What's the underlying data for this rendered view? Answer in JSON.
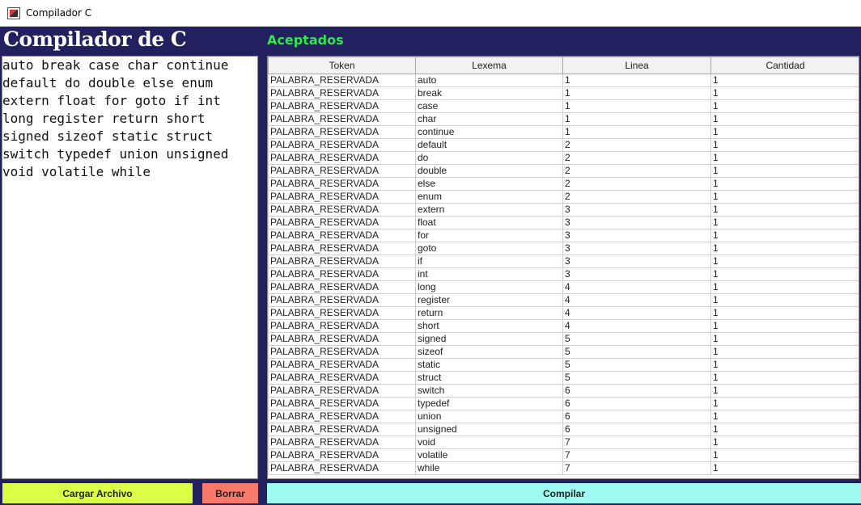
{
  "window": {
    "title": "Compilador C",
    "icon": "java-cup-icon"
  },
  "editor": {
    "heading": "Compilador de C",
    "content": "auto break case char continue\ndefault do double else enum\nextern float for goto if int\nlong register return short\nsigned sizeof static struct\nswitch typedef union unsigned\nvoid volatile while"
  },
  "results": {
    "heading": "Aceptados",
    "columns": [
      "Token",
      "Lexema",
      "Linea",
      "Cantidad"
    ],
    "rows": [
      [
        "PALABRA_RESERVADA",
        "auto",
        "1",
        "1"
      ],
      [
        "PALABRA_RESERVADA",
        "break",
        "1",
        "1"
      ],
      [
        "PALABRA_RESERVADA",
        "case",
        "1",
        "1"
      ],
      [
        "PALABRA_RESERVADA",
        "char",
        "1",
        "1"
      ],
      [
        "PALABRA_RESERVADA",
        "continue",
        "1",
        "1"
      ],
      [
        "PALABRA_RESERVADA",
        "default",
        "2",
        "1"
      ],
      [
        "PALABRA_RESERVADA",
        "do",
        "2",
        "1"
      ],
      [
        "PALABRA_RESERVADA",
        "double",
        "2",
        "1"
      ],
      [
        "PALABRA_RESERVADA",
        "else",
        "2",
        "1"
      ],
      [
        "PALABRA_RESERVADA",
        "enum",
        "2",
        "1"
      ],
      [
        "PALABRA_RESERVADA",
        "extern",
        "3",
        "1"
      ],
      [
        "PALABRA_RESERVADA",
        "float",
        "3",
        "1"
      ],
      [
        "PALABRA_RESERVADA",
        "for",
        "3",
        "1"
      ],
      [
        "PALABRA_RESERVADA",
        "goto",
        "3",
        "1"
      ],
      [
        "PALABRA_RESERVADA",
        "if",
        "3",
        "1"
      ],
      [
        "PALABRA_RESERVADA",
        "int",
        "3",
        "1"
      ],
      [
        "PALABRA_RESERVADA",
        "long",
        "4",
        "1"
      ],
      [
        "PALABRA_RESERVADA",
        "register",
        "4",
        "1"
      ],
      [
        "PALABRA_RESERVADA",
        "return",
        "4",
        "1"
      ],
      [
        "PALABRA_RESERVADA",
        "short",
        "4",
        "1"
      ],
      [
        "PALABRA_RESERVADA",
        "signed",
        "5",
        "1"
      ],
      [
        "PALABRA_RESERVADA",
        "sizeof",
        "5",
        "1"
      ],
      [
        "PALABRA_RESERVADA",
        "static",
        "5",
        "1"
      ],
      [
        "PALABRA_RESERVADA",
        "struct",
        "5",
        "1"
      ],
      [
        "PALABRA_RESERVADA",
        "switch",
        "6",
        "1"
      ],
      [
        "PALABRA_RESERVADA",
        "typedef",
        "6",
        "1"
      ],
      [
        "PALABRA_RESERVADA",
        "union",
        "6",
        "1"
      ],
      [
        "PALABRA_RESERVADA",
        "unsigned",
        "6",
        "1"
      ],
      [
        "PALABRA_RESERVADA",
        "void",
        "7",
        "1"
      ],
      [
        "PALABRA_RESERVADA",
        "volatile",
        "7",
        "1"
      ],
      [
        "PALABRA_RESERVADA",
        "while",
        "7",
        "1"
      ]
    ]
  },
  "buttons": {
    "load": "Cargar Archivo",
    "clear": "Borrar",
    "compile": "Compilar"
  },
  "colors": {
    "background": "#22205e",
    "accepted_heading": "#2ee84a",
    "load_button": "#dbff45",
    "clear_button": "#f8786a",
    "compile_button": "#9efbf2"
  }
}
